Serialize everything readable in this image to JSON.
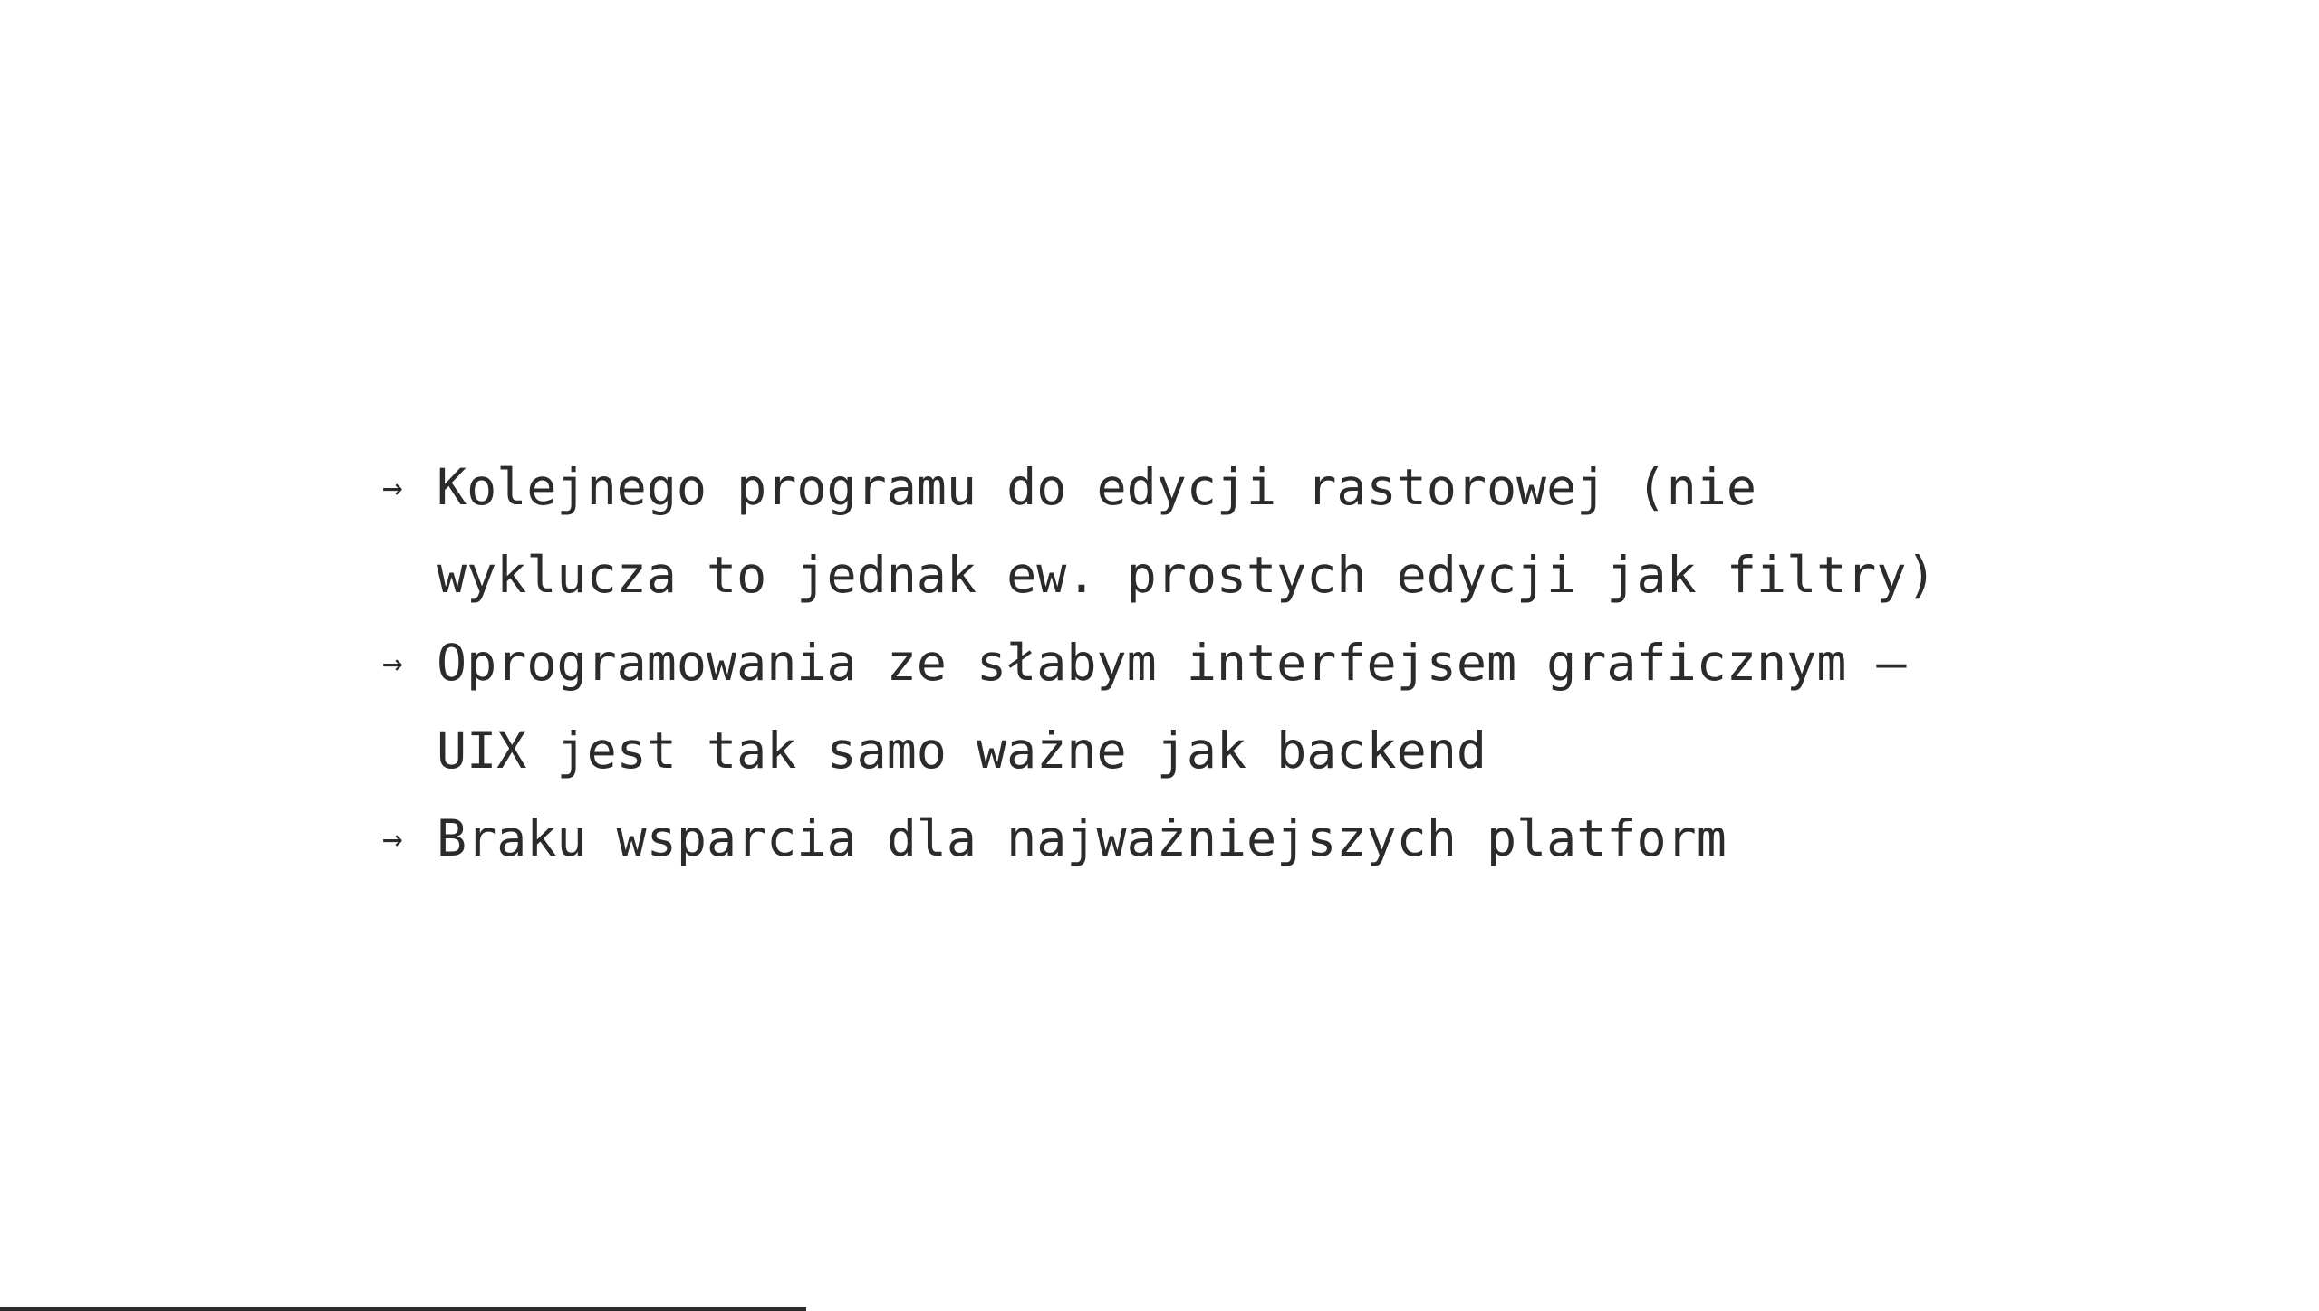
{
  "slide": {
    "bullets": [
      {
        "marker": "→",
        "text": "Kolejnego programu do edycji rastorowej (nie wyklucza to jednak ew. prostych edycji jak filtry)"
      },
      {
        "marker": "→",
        "text": "Oprogramowania ze słabym interfejsem graficznym – UIX jest tak samo ważne jak backend"
      },
      {
        "marker": "→",
        "text": "Braku wsparcia dla najważniejszych platform"
      }
    ]
  },
  "colors": {
    "background": "#ffffff",
    "text": "#2b2b2b",
    "rule": "#2b2b2b"
  }
}
